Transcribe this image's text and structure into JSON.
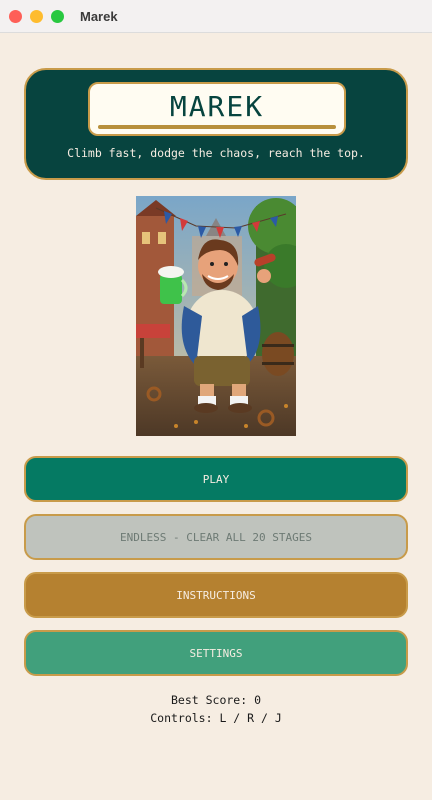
{
  "window": {
    "title": "Marek"
  },
  "header": {
    "logo": "MAREK",
    "tagline": "Climb fast, dodge the chaos, reach the top."
  },
  "hero_image": {
    "description_icon": "character-illustration"
  },
  "menu": {
    "play_label": "PLAY",
    "endless_label": "ENDLESS - CLEAR ALL 20 STAGES",
    "instructions_label": "INSTRUCTIONS",
    "settings_label": "SETTINGS"
  },
  "footer": {
    "best_score": "Best Score: 0",
    "controls": "Controls: L / R / J"
  },
  "colors": {
    "background": "#f6ede2",
    "header": "#07443f",
    "gold": "#c89b4a",
    "play": "#057a63",
    "endless_disabled": "#bfc3bd",
    "instructions": "#b58130",
    "settings": "#41a07c"
  }
}
